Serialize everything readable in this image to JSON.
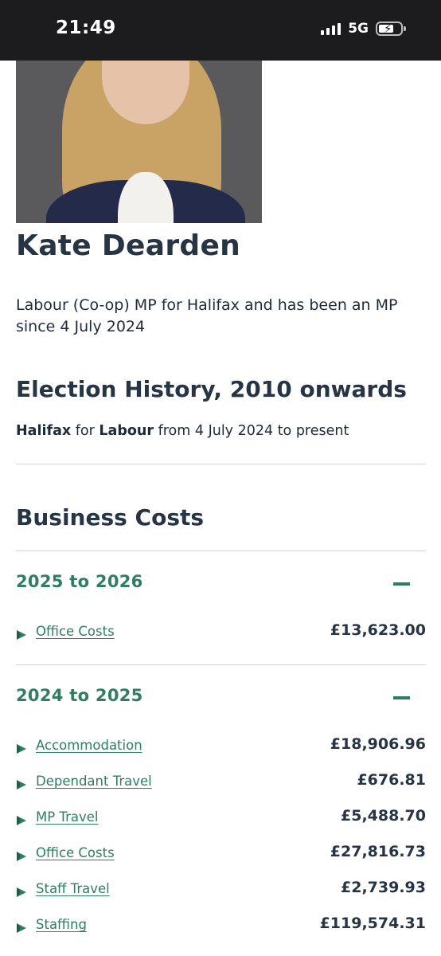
{
  "status_bar": {
    "time": "21:49",
    "network": "5G",
    "battery_level": 0.55
  },
  "profile": {
    "name": "Kate Dearden",
    "description": "Labour (Co-op) MP for Halifax and has been an MP since 4 July 2024"
  },
  "election_history": {
    "title": "Election History, 2010 onwards",
    "entry": {
      "constituency": "Halifax",
      "for_word": "for",
      "party": "Labour",
      "period": "from 4 July 2024 to present"
    }
  },
  "business_costs": {
    "title": "Business Costs",
    "years": [
      {
        "label": "2025 to 2026",
        "items": [
          {
            "label": "Office Costs",
            "amount": "£13,623.00"
          }
        ]
      },
      {
        "label": "2024 to 2025",
        "items": [
          {
            "label": "Accommodation",
            "amount": "£18,906.96"
          },
          {
            "label": "Dependant Travel",
            "amount": "£676.81"
          },
          {
            "label": "MP Travel",
            "amount": "£5,488.70"
          },
          {
            "label": "Office Costs",
            "amount": "£27,816.73"
          },
          {
            "label": "Staff Travel",
            "amount": "£2,739.93"
          },
          {
            "label": "Staffing",
            "amount": "£119,574.31"
          }
        ]
      }
    ]
  },
  "colors": {
    "accent": "#2f7d62",
    "text": "#273444",
    "status_bar": "#1c1c1e"
  }
}
